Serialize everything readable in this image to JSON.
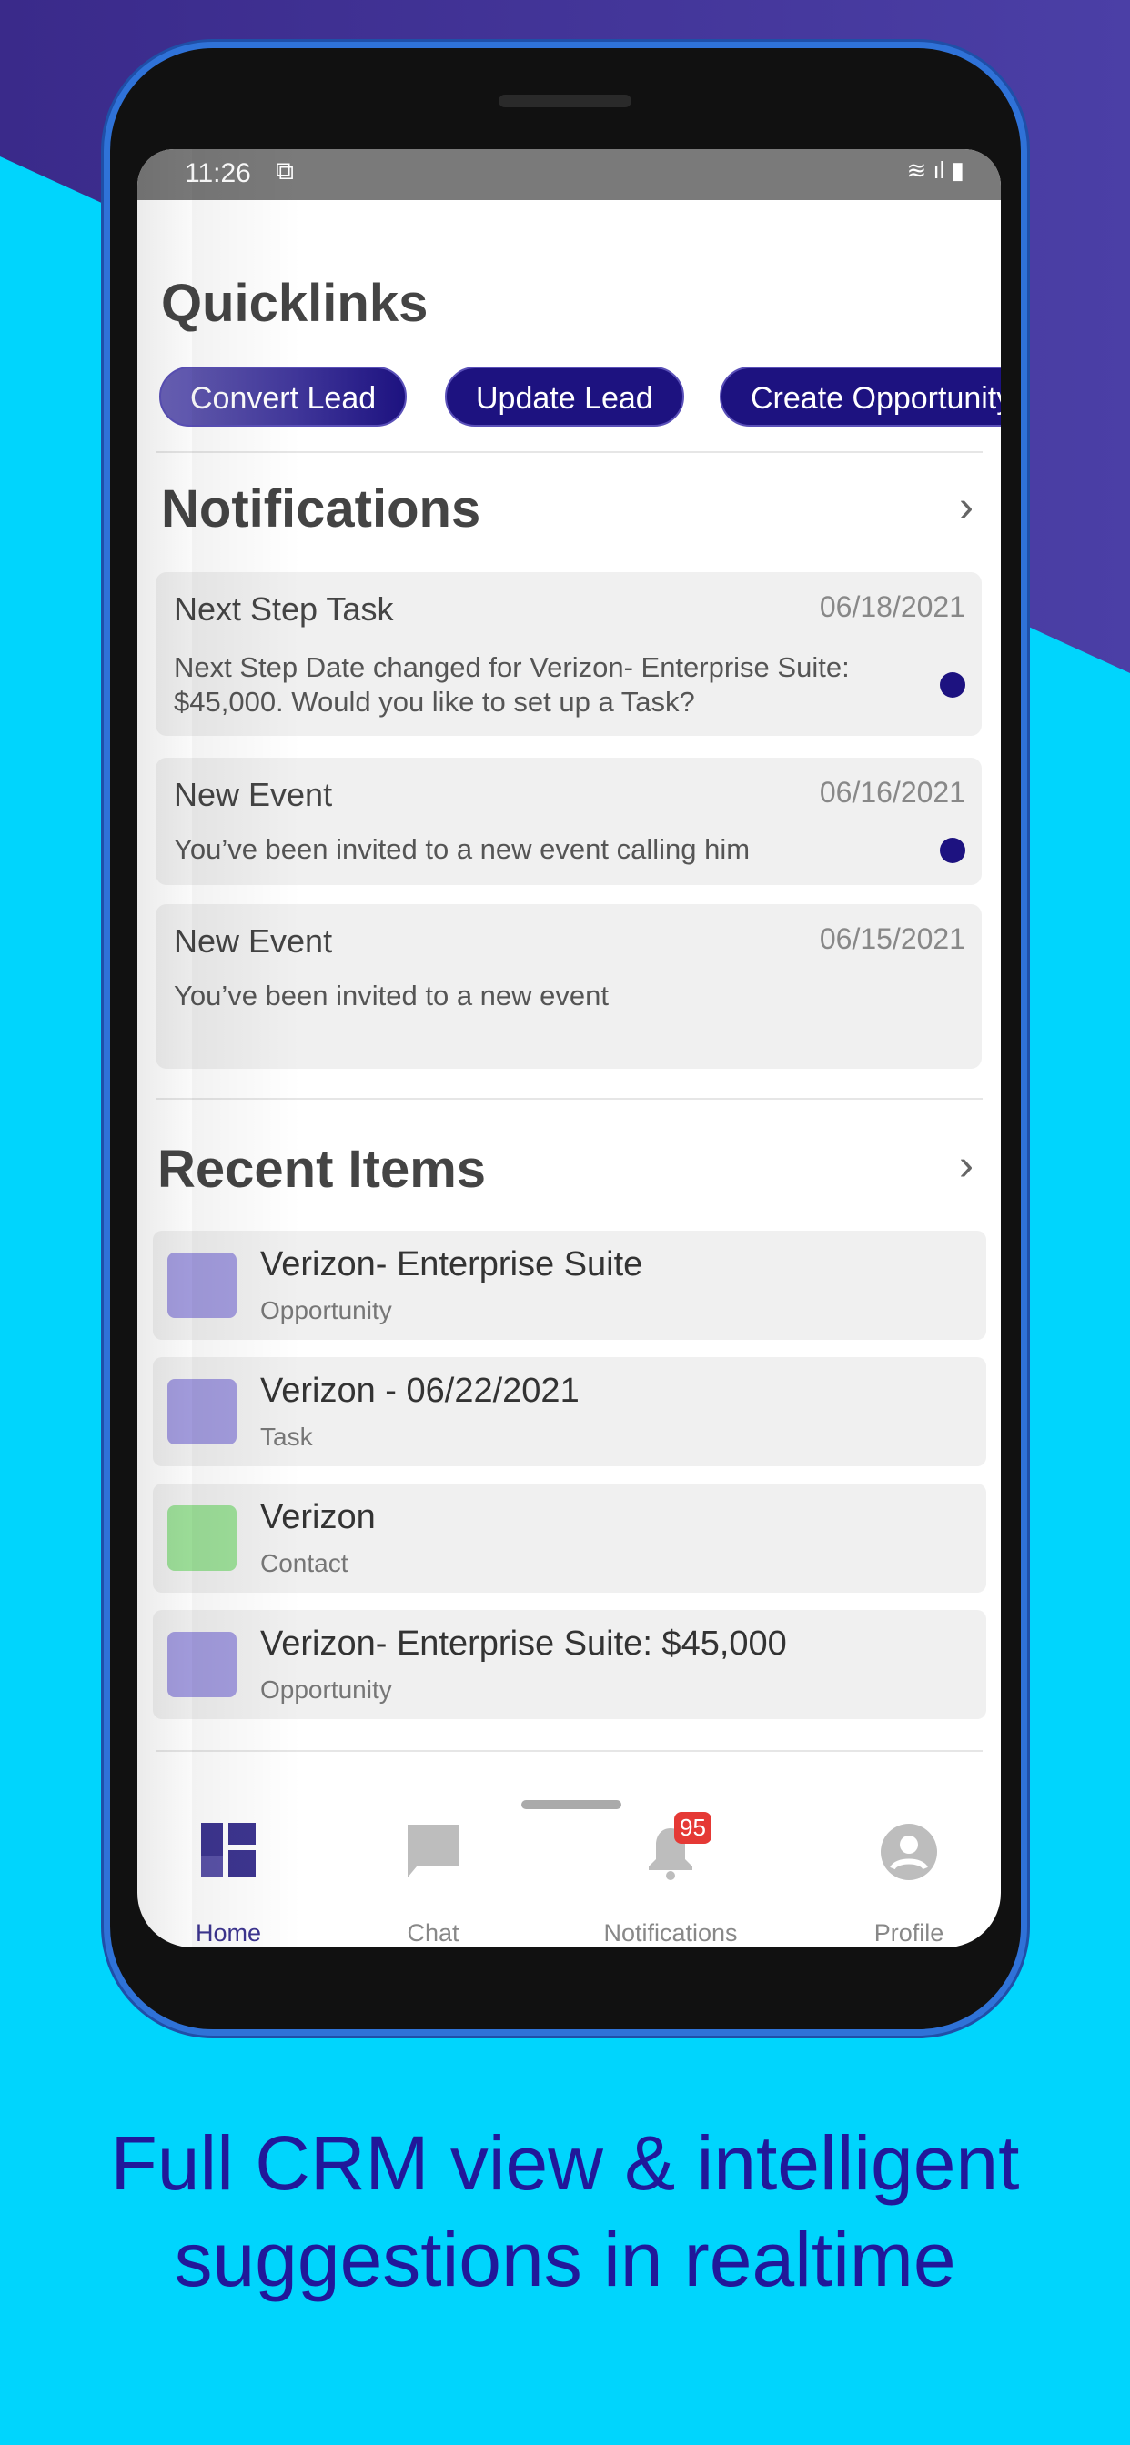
{
  "status_bar": {
    "time": "11:26"
  },
  "quicklinks": {
    "title": "Quicklinks",
    "buttons": [
      "Convert Lead",
      "Update Lead",
      "Create Opportunity"
    ]
  },
  "notifications": {
    "title": "Notifications",
    "items": [
      {
        "title": "Next Step Task",
        "date": "06/18/2021",
        "body": "Next Step Date changed for Verizon- Enterprise Suite: $45,000. Would you like to set up a Task?",
        "unread": true
      },
      {
        "title": "New Event",
        "date": "06/16/2021",
        "body": "You’ve been invited to a new event calling him",
        "unread": true
      },
      {
        "title": "New Event",
        "date": "06/15/2021",
        "body": "You’ve been invited to a new event",
        "unread": false
      }
    ]
  },
  "recent": {
    "title": "Recent Items",
    "items": [
      {
        "title": "Verizon- Enterprise Suite",
        "type": "Opportunity",
        "icon": "folder-icon"
      },
      {
        "title": "Verizon - 06/22/2021",
        "type": "Task",
        "icon": "folder-icon"
      },
      {
        "title": "Verizon",
        "type": "Contact",
        "icon": "contact-icon"
      },
      {
        "title": "Verizon- Enterprise Suite: $45,000",
        "type": "Opportunity",
        "icon": "folder-icon"
      }
    ]
  },
  "nav": {
    "items": [
      {
        "label": "Home",
        "active": true
      },
      {
        "label": "Chat"
      },
      {
        "label": "Notifications",
        "badge": "95"
      },
      {
        "label": "Profile"
      }
    ]
  },
  "caption": {
    "line1": "Full CRM view & intelligent",
    "line2": "suggestions in realtime"
  },
  "colors": {
    "accent": "#1d1280",
    "background": "#00d5fd",
    "badge": "#e53935"
  }
}
